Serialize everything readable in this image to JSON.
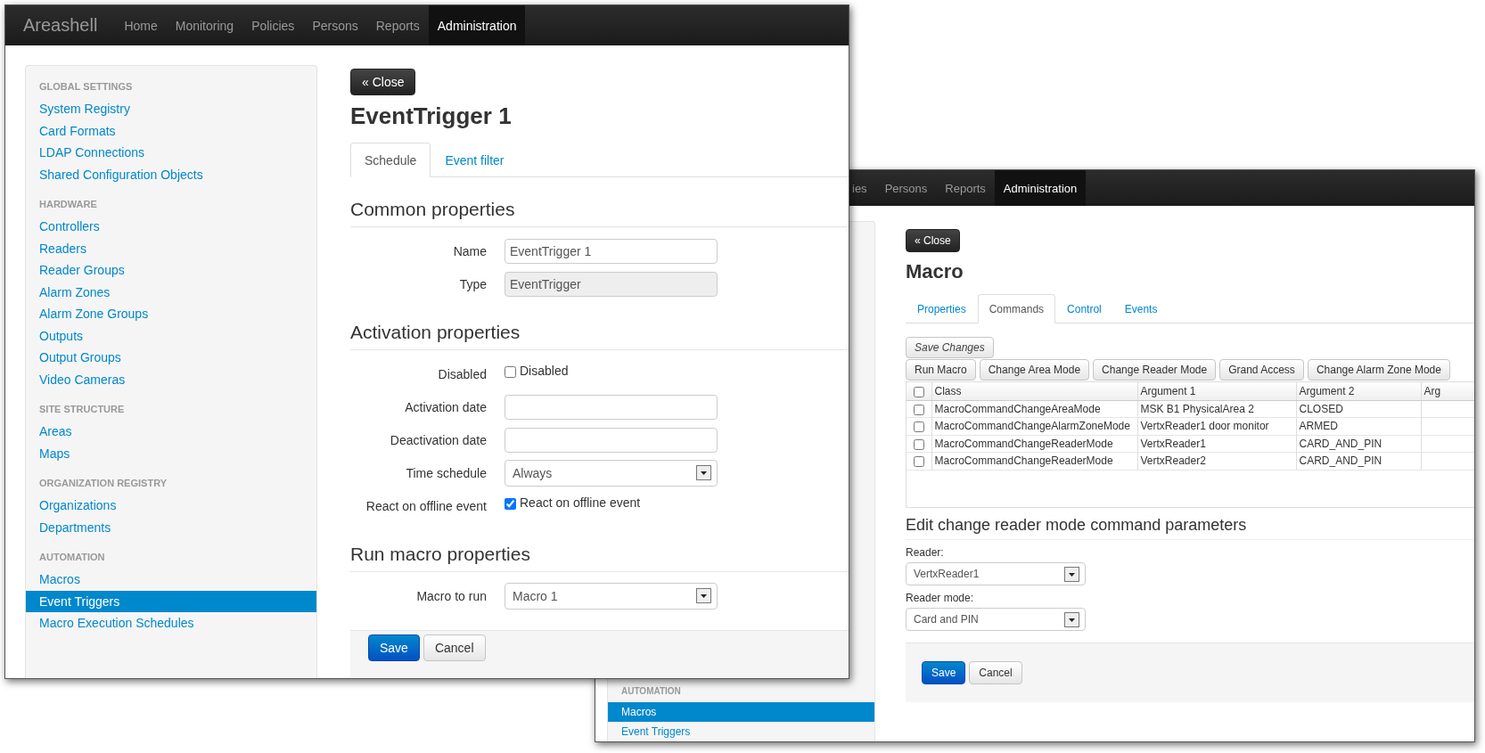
{
  "event_trigger_window": {
    "brand": "Areashell",
    "nav": [
      {
        "label": "Home",
        "selected": false
      },
      {
        "label": "Monitoring",
        "selected": false
      },
      {
        "label": "Policies",
        "selected": false
      },
      {
        "label": "Persons",
        "selected": false
      },
      {
        "label": "Reports",
        "selected": false
      },
      {
        "label": "Administration",
        "selected": true
      }
    ],
    "sidebar": [
      {
        "title": "GLOBAL SETTINGS",
        "items": [
          {
            "label": "System Registry",
            "selected": false
          },
          {
            "label": "Card Formats",
            "selected": false
          },
          {
            "label": "LDAP Connections",
            "selected": false
          },
          {
            "label": "Shared Configuration Objects",
            "selected": false
          }
        ]
      },
      {
        "title": "HARDWARE",
        "items": [
          {
            "label": "Controllers",
            "selected": false
          },
          {
            "label": "Readers",
            "selected": false
          },
          {
            "label": "Reader Groups",
            "selected": false
          },
          {
            "label": "Alarm Zones",
            "selected": false
          },
          {
            "label": "Alarm Zone Groups",
            "selected": false
          },
          {
            "label": "Outputs",
            "selected": false
          },
          {
            "label": "Output Groups",
            "selected": false
          },
          {
            "label": "Video Cameras",
            "selected": false
          }
        ]
      },
      {
        "title": "SITE STRUCTURE",
        "items": [
          {
            "label": "Areas",
            "selected": false
          },
          {
            "label": "Maps",
            "selected": false
          }
        ]
      },
      {
        "title": "ORGANIZATION REGISTRY",
        "items": [
          {
            "label": "Organizations",
            "selected": false
          },
          {
            "label": "Departments",
            "selected": false
          }
        ]
      },
      {
        "title": "AUTOMATION",
        "items": [
          {
            "label": "Macros",
            "selected": false
          },
          {
            "label": "Event Triggers",
            "selected": true
          },
          {
            "label": "Macro Execution Schedules",
            "selected": false
          }
        ]
      }
    ],
    "close_button": "« Close",
    "title": "EventTrigger 1",
    "tabs": [
      {
        "label": "Schedule",
        "selected": true
      },
      {
        "label": "Event filter",
        "selected": false
      }
    ],
    "sections": [
      {
        "heading": "Common properties",
        "fields": [
          {
            "kind": "text",
            "label": "Name",
            "value": "EventTrigger 1"
          },
          {
            "kind": "readonly",
            "label": "Type",
            "value": "EventTrigger"
          }
        ]
      },
      {
        "heading": "Activation properties",
        "fields": [
          {
            "kind": "checkbox",
            "label": "Disabled",
            "text": "Disabled",
            "checked": false
          },
          {
            "kind": "text",
            "label": "Activation date"
          },
          {
            "kind": "text",
            "label": "Deactivation date"
          },
          {
            "kind": "select",
            "label": "Time schedule",
            "value": "Always"
          },
          {
            "kind": "checkbox",
            "label": "React on offline event",
            "text": "React on offline event",
            "checked": true
          }
        ]
      },
      {
        "heading": "Run macro properties",
        "fields": [
          {
            "kind": "select",
            "label": "Macro to run",
            "value": "Macro 1"
          }
        ]
      }
    ],
    "buttons": [
      {
        "label": "Save",
        "kind": "primary"
      },
      {
        "label": "Cancel",
        "kind": "default"
      }
    ]
  },
  "macro_window": {
    "nav": [
      {
        "label": "ies",
        "selected": false
      },
      {
        "label": "Persons",
        "selected": false
      },
      {
        "label": "Reports",
        "selected": false
      },
      {
        "label": "Administration",
        "selected": true
      }
    ],
    "sidebar": [
      {
        "title": "AUTOMATION",
        "items": [
          {
            "label": "Macros",
            "selected": true
          },
          {
            "label": "Event Triggers",
            "selected": false
          }
        ]
      }
    ],
    "close_button": "« Close",
    "title": "Macro",
    "tabs": [
      {
        "label": "Properties",
        "selected": false
      },
      {
        "label": "Commands",
        "selected": true
      },
      {
        "label": "Control",
        "selected": false
      },
      {
        "label": "Events",
        "selected": false
      }
    ],
    "save_changes": {
      "label": "Save Changes",
      "disabled": true
    },
    "command_buttons": [
      "Run Macro",
      "Change Area Mode",
      "Change Reader Mode",
      "Grand Access",
      "Change Alarm Zone Mode"
    ],
    "table": {
      "select_all_checked": false,
      "columns": [
        "Class",
        "Argument 1",
        "Argument 2",
        "Arg"
      ],
      "rows": [
        {
          "checked": false,
          "cells": [
            "MacroCommandChangeAreaMode",
            "MSK B1 PhysicalArea 2",
            "CLOSED"
          ]
        },
        {
          "checked": false,
          "cells": [
            "MacroCommandChangeAlarmZoneMode",
            "VertxReader1 door monitor",
            "ARMED"
          ]
        },
        {
          "checked": false,
          "cells": [
            "MacroCommandChangeReaderMode",
            "VertxReader1",
            "CARD_AND_PIN"
          ]
        },
        {
          "checked": false,
          "cells": [
            "MacroCommandChangeReaderMode",
            "VertxReader2",
            "CARD_AND_PIN"
          ]
        }
      ]
    },
    "edit_heading": "Edit change reader mode command parameters",
    "fields": [
      {
        "kind": "select",
        "label": "Reader:",
        "value": "VertxReader1"
      },
      {
        "kind": "select",
        "label": "Reader mode:",
        "value": "Card and PIN"
      }
    ],
    "buttons": [
      {
        "label": "Save",
        "kind": "primary"
      },
      {
        "label": "Cancel",
        "kind": "default"
      }
    ]
  }
}
